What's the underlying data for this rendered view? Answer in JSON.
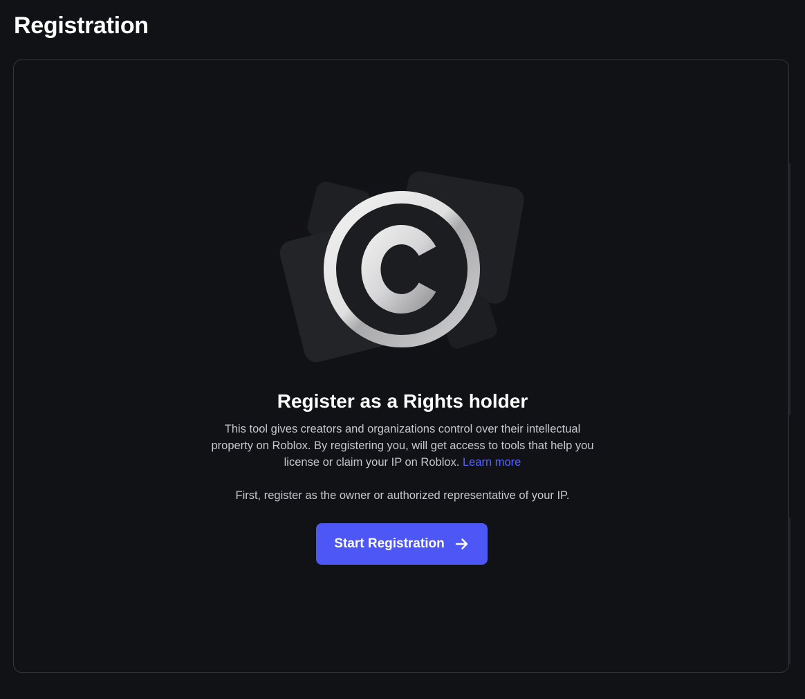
{
  "page": {
    "title": "Registration"
  },
  "hero": {
    "icon": "copyright-icon",
    "heading": "Register as a Rights holder",
    "description": "This tool gives creators and organizations control over their intellectual property on Roblox. By registering you, will get access to tools that help you license or claim your IP on Roblox.",
    "learn_more": "Learn more",
    "instruction": "First, register as the owner or authorized representative of your IP."
  },
  "actions": {
    "start_label": "Start Registration",
    "start_icon": "arrow-right-icon"
  },
  "colors": {
    "background": "#111216",
    "accent": "#4c57f5",
    "link": "#5563ff",
    "body_text": "#c6c8cd"
  }
}
